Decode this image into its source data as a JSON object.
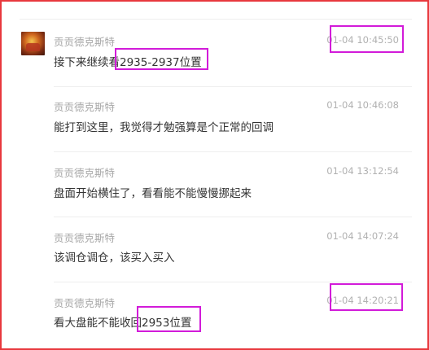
{
  "messages": [
    {
      "author": "贡贡德克斯特",
      "time": "01-04 10:45:50",
      "text": "接下来继续看2935-2937位置"
    },
    {
      "author": "贡贡德克斯特",
      "time": "01-04 10:46:08",
      "text": "能打到这里，我觉得才勉强算是个正常的回调"
    },
    {
      "author": "贡贡德克斯特",
      "time": "01-04 13:12:54",
      "text": "盘面开始横住了，看看能不能慢慢挪起来"
    },
    {
      "author": "贡贡德克斯特",
      "time": "01-04 14:07:24",
      "text": "该调仓调仓，该买入买入"
    },
    {
      "author": "贡贡德克斯特",
      "time": "01-04 14:20:21",
      "text": "看大盘能不能收回2953位置"
    }
  ],
  "colors": {
    "frame": "#e8383d",
    "highlight": "#d21bd9",
    "author": "#a7a7a7",
    "time": "#b1b1b1",
    "text": "#333333"
  }
}
